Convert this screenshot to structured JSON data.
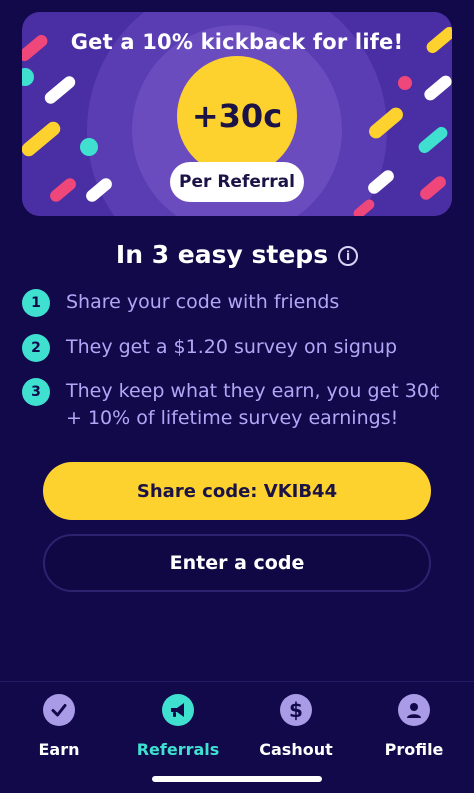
{
  "banner": {
    "title": "Get a 10% kickback for life!",
    "coin_value": "+30c",
    "pill_label": "Per Referral"
  },
  "steps": {
    "title": "In 3 easy steps",
    "info_glyph": "i",
    "items": [
      {
        "num": "1",
        "text": "Share your code with friends"
      },
      {
        "num": "2",
        "text": "They get a $1.20 survey on signup"
      },
      {
        "num": "3",
        "text": "They keep what they earn, you get 30¢ + 10% of lifetime survey earnings!"
      }
    ]
  },
  "buttons": {
    "share_label": "Share code: VKIB44",
    "enter_label": "Enter a code"
  },
  "nav": {
    "items": [
      {
        "label": "Earn",
        "icon": "check-circle-icon"
      },
      {
        "label": "Referrals",
        "icon": "megaphone-icon",
        "active": true
      },
      {
        "label": "Cashout",
        "icon": "dollar-icon"
      },
      {
        "label": "Profile",
        "icon": "user-icon"
      }
    ]
  },
  "colors": {
    "background": "#12094a",
    "banner": "#4a2ea3",
    "accent_yellow": "#fdd22f",
    "accent_teal": "#3fe0d0",
    "step_text": "#b3a6f7"
  }
}
